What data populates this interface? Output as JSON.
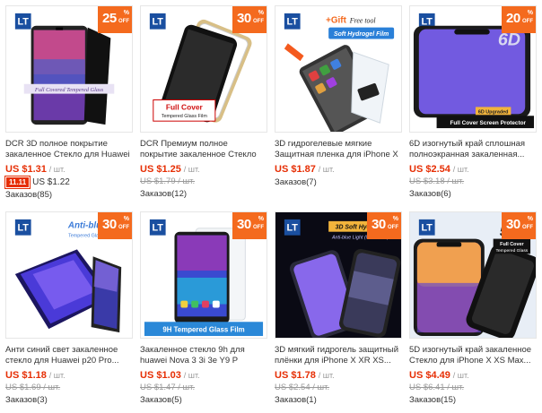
{
  "products": [
    {
      "title": "DCR 3D полное покрытие закаленное Стекло для Huawei p20...",
      "price": "US $1.31",
      "unit": "/ шт.",
      "promo_tag": "11.11",
      "promo_price": "US $1.22",
      "old_price": "",
      "orders": "Заказов(85)",
      "discount": "25",
      "banner": "Full Covered Tempered Glass",
      "logo": "LT"
    },
    {
      "title": "DCR Премиум полное покрытие закаленное Стекло для One...",
      "price": "US $1.25",
      "unit": "/ шт.",
      "old_price": "US $1.79 / шт.",
      "orders": "Заказов(12)",
      "discount": "30",
      "banner": "Full Cover",
      "banner2": "Tempered Glass Film",
      "logo": "LT"
    },
    {
      "title": "3D гидрогелевые мягкие Защитная пленка для iPhone X XS...",
      "price": "US $1.87",
      "unit": "/ шт.",
      "old_price": "",
      "orders": "Заказов(7)",
      "discount": "",
      "gift": "+Gift",
      "gift2": "Free tool",
      "banner": "Soft Hydrogel Film",
      "logo": "LT"
    },
    {
      "title": "6D изогнутый край сплошная полноэкранная закаленная...",
      "price": "US $2.54",
      "unit": "/ шт.",
      "old_price": "US $3.18 / шт.",
      "orders": "Заказов(6)",
      "discount": "20",
      "big": "6D",
      "banner": "6D Upgraded",
      "banner2": "Full Cover Screen Protector",
      "logo": "LT"
    },
    {
      "title": "Анти синий свет закаленное стекло для Huawei p20 Pro...",
      "price": "US $1.18",
      "unit": "/ шт.",
      "old_price": "US $1.69 / шт.",
      "orders": "Заказов(3)",
      "discount": "30",
      "banner": "Anti-blue L",
      "banner2": "Tempered Glass Film",
      "logo": "LT"
    },
    {
      "title": "Закаленное стекло 9h для huawei Nova 3 3i 3e Y9 P Smart...",
      "price": "US $1.03",
      "unit": "/ шт.",
      "old_price": "US $1.47 / шт.",
      "orders": "Заказов(5)",
      "discount": "30",
      "banner": "9H Tempered Glass Film",
      "logo": "LT"
    },
    {
      "title": "3D мягкий гидрогель защитный плёнки для iPhone X XR XS...",
      "price": "US $1.78",
      "unit": "/ шт.",
      "old_price": "US $2.54 / шт.",
      "orders": "Заказов(1)",
      "discount": "30",
      "banner": "3D Soft Hydrogel",
      "banner2": "Anti-blue Light (Not Glass)",
      "logo": "LT"
    },
    {
      "title": "5D изогнутый край закаленное Стекло для iPhone X XS Max...",
      "price": "US $4.49",
      "unit": "/ шт.",
      "old_price": "US $6.41 / шт.",
      "orders": "Заказов(15)",
      "discount": "30",
      "big": "5D",
      "banner": "Full Cover",
      "banner2": "Tempered Glass",
      "logo": "LT"
    }
  ],
  "badge_pct": "%",
  "badge_off": "OFF",
  "colors": {
    "accent": "#f46a1e",
    "price": "#e62e04",
    "muted": "#999999",
    "logo_blue": "#1a4fa0"
  }
}
